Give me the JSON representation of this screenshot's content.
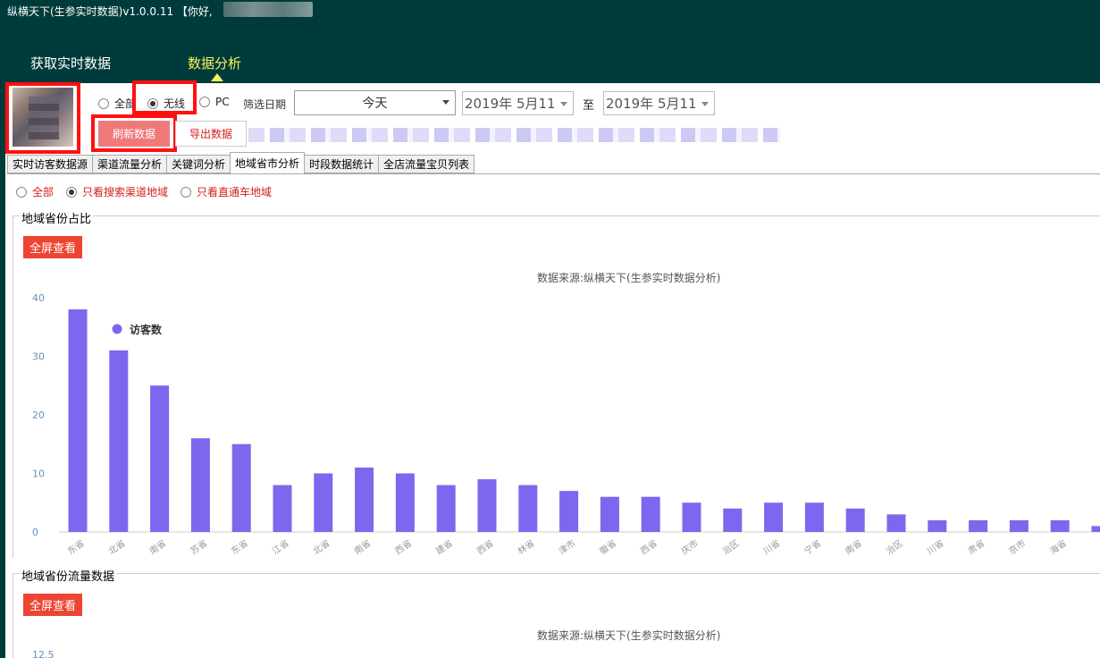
{
  "window": {
    "title": "纵横天下(生参实时数据)v1.0.0.11 【你好,"
  },
  "nav": {
    "tabs": [
      {
        "label": "获取实时数据"
      },
      {
        "label": "数据分析"
      }
    ]
  },
  "device_filter": {
    "options": [
      "全部",
      "无线",
      "PC"
    ],
    "selected": "无线"
  },
  "date_filter": {
    "label": "筛选日期",
    "preset": "今天",
    "from": "2019年 5月11",
    "to_label": "至",
    "to": "2019年 5月11"
  },
  "actions": {
    "refresh": "刷新数据",
    "export": "导出数据"
  },
  "tabs": [
    {
      "label": "实时访客数据源"
    },
    {
      "label": "渠道流量分析"
    },
    {
      "label": "关键词分析"
    },
    {
      "label": "地域省市分析"
    },
    {
      "label": "时段数据统计"
    },
    {
      "label": "全店流量宝贝列表"
    }
  ],
  "active_tab": "地域省市分析",
  "region_filter": {
    "options": [
      "全部",
      "只看搜索渠道地域",
      "只看直通车地域"
    ],
    "selected": "只看搜索渠道地域"
  },
  "section1": {
    "title": "地域省份占比",
    "fullscreen": "全屏查看",
    "source": "数据来源:纵横天下(生参实时数据分析)"
  },
  "section2": {
    "title": "地域省份流量数据",
    "fullscreen": "全屏查看",
    "source": "数据来源:纵横天下(生参实时数据分析)",
    "y_top_tick": "12.5"
  },
  "colors": {
    "bar": "#7b68ee",
    "header": "#003b3b",
    "nav_active": "#f8f35a",
    "highlight": "#ff1010"
  },
  "chart_data": {
    "type": "bar",
    "legend": "访客数",
    "legend_position": "top-left",
    "ylim": [
      0,
      40
    ],
    "yticks": [
      0,
      10,
      20,
      30,
      40
    ],
    "grid": false,
    "categories": [
      "东省",
      "北省",
      "南省",
      "苏省",
      "东省",
      "江省",
      "北省",
      "南省",
      "西省",
      "建省",
      "西省",
      "林省",
      "津市",
      "徽省",
      "西省",
      "庆市",
      "治区",
      "川省",
      "宁省",
      "南省",
      "治区",
      "川省",
      "肃省",
      "京市",
      "海省",
      "夏市"
    ],
    "values": [
      38,
      31,
      25,
      16,
      15,
      8,
      10,
      11,
      10,
      8,
      9,
      8,
      7,
      6,
      6,
      5,
      4,
      5,
      5,
      4,
      3,
      2,
      2,
      2,
      2,
      1
    ]
  }
}
